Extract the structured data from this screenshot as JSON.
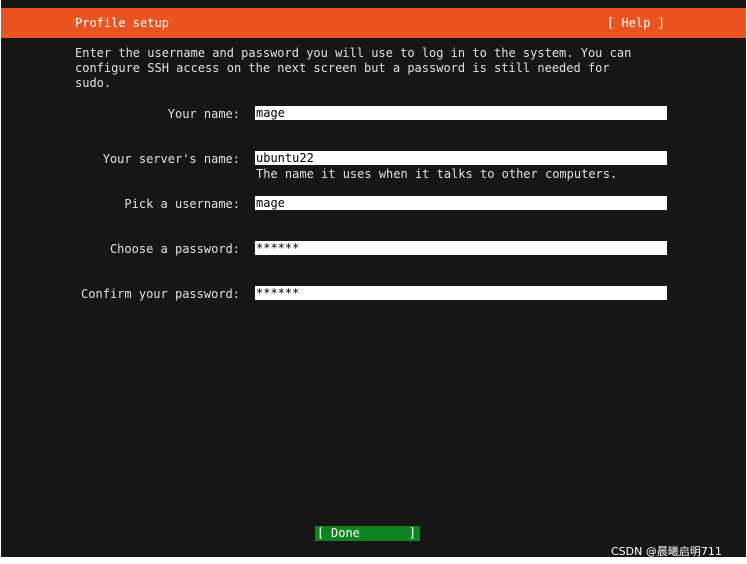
{
  "header": {
    "title": "Profile setup",
    "help": "[ Help ]"
  },
  "intro": {
    "lines": [
      "Enter the username and password you will use to log in to the system. You can",
      "configure SSH access on the next screen but a password is still needed for",
      "sudo."
    ]
  },
  "form": {
    "name": {
      "label": "Your name:",
      "value": "mage"
    },
    "server": {
      "label": "Your server's name:",
      "value": "ubuntu22",
      "hint": "The name it uses when it talks to other computers."
    },
    "username": {
      "label": "Pick a username:",
      "value": "mage"
    },
    "password": {
      "label": "Choose a password:",
      "value": "******"
    },
    "confirm": {
      "label": "Confirm your password:",
      "value": "******"
    }
  },
  "footer": {
    "done_bracket_left": "[",
    "done_label": "Done",
    "done_bracket_right": "]"
  },
  "watermark": "CSDN @晨曦启明711",
  "colors": {
    "titlebar": "#e95420",
    "background": "#161616",
    "done_button": "#0e8420"
  }
}
